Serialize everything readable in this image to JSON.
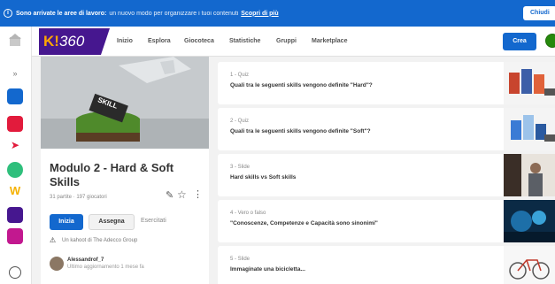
{
  "banner": {
    "strong": "Sono arrivate le aree di lavoro:",
    "text": "un nuovo modo per organizzare i tuoi contenuti",
    "link": "Scopri di più",
    "close_label": "Chiudi"
  },
  "nav": {
    "logo_prefix": "K!",
    "logo_number": "360",
    "items": [
      "Inizio",
      "Esplora",
      "Giocoteca",
      "Statistiche",
      "Gruppi",
      "Marketplace"
    ],
    "create_label": "Crea"
  },
  "kahoot": {
    "title": "Modulo 2 - Hard & Soft Skills",
    "meta": "31 partite · 197 giocatori",
    "play_label": "Inizia",
    "assign_label": "Assegna",
    "practice_label": "Esercitati",
    "origin": "Un kahoot di The Adecco Group",
    "author": "Alessandrof_7",
    "updated": "Ultimo aggiornamento 1 mese fa",
    "cover_text": "SKILL"
  },
  "questions": [
    {
      "type": "1 - Quiz",
      "title": "Quali tra le seguenti skills vengono definite \"Hard\"?"
    },
    {
      "type": "2 - Quiz",
      "title": "Quali tra le seguenti skills vengono definite \"Soft\"?"
    },
    {
      "type": "3 - Slide",
      "title": "Hard skills vs Soft skills"
    },
    {
      "type": "4 - Vero o falso",
      "title": "\"Conoscenze, Competenze e Capacità sono sinonimi\""
    },
    {
      "type": "5 - Slide",
      "title": "Immaginate una bicicletta..."
    }
  ],
  "colors": {
    "brand": "#46178f",
    "accent": "#1368ce",
    "logo_accent": "#ffa602",
    "profile": "#26890c"
  },
  "icons": {
    "banner": "info-icon",
    "rail": [
      "home-icon",
      "menu-icon",
      "app-blue-icon",
      "app-red-icon",
      "arrow-icon",
      "app-green-icon",
      "w-icon",
      "app-purple-icon",
      "app-magenta-icon",
      "help-icon"
    ]
  }
}
